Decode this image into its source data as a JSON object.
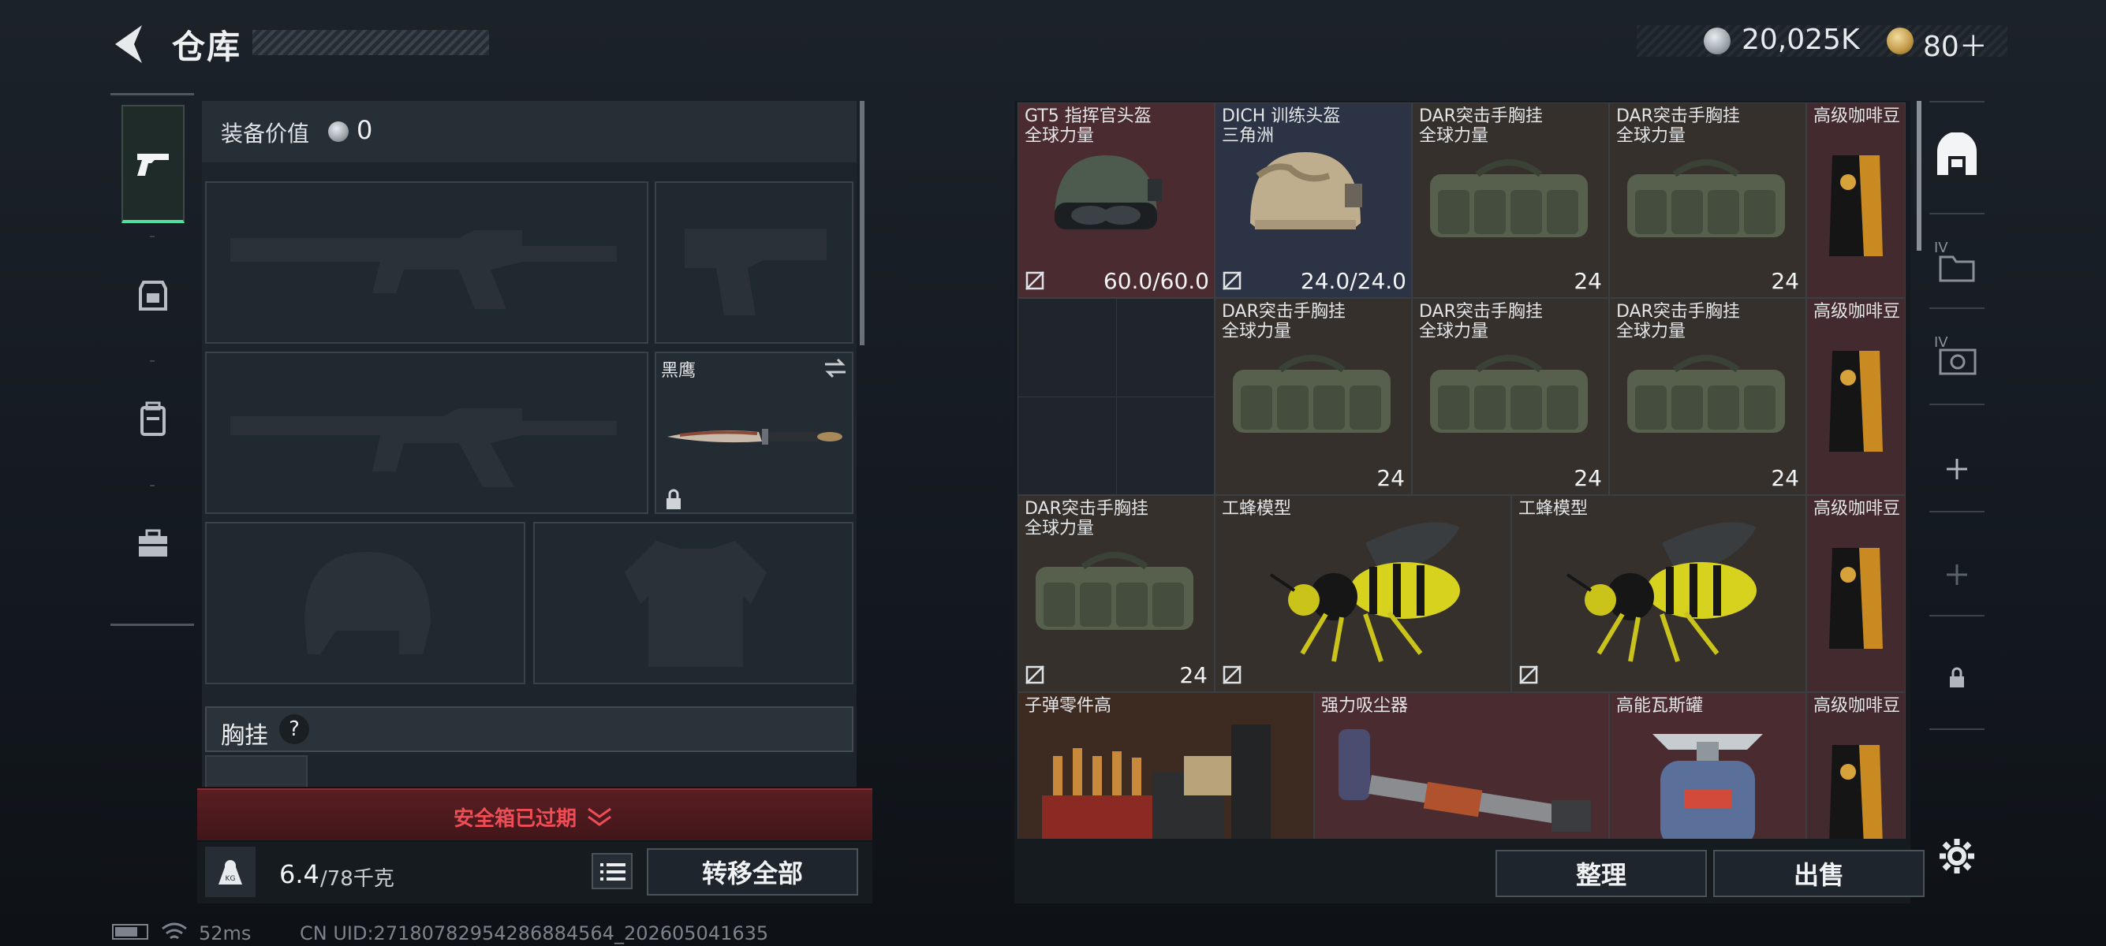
{
  "header": {
    "title": "仓库"
  },
  "currency": {
    "silver": "20,025K",
    "gold": "80＋"
  },
  "left_tabs": [
    {
      "name": "pistol-icon",
      "active": true
    },
    {
      "name": "armor-icon",
      "active": false
    },
    {
      "name": "backpack-icon",
      "active": false
    },
    {
      "name": "toolbox-icon",
      "active": false
    }
  ],
  "equipment": {
    "value_label": "装备价值",
    "value": "0",
    "melee_name": "黑鹰",
    "rig_label": "胸挂",
    "rig_help": "?"
  },
  "safe_box": {
    "label": "安全箱已过期"
  },
  "weight": {
    "current": "6.4",
    "max": "/78千克",
    "transfer_button": "转移全部"
  },
  "status": {
    "ping": "52ms",
    "uid": "CN UID:2718078295428688­4564_202605041635"
  },
  "storage": {
    "items": [
      {
        "key": "gt5",
        "line1": "GT5 指挥官头盔",
        "line2": "全球力量",
        "value": "60.0/60.0"
      },
      {
        "key": "dich",
        "line1": "DICH 训练头盔",
        "line2": "三角洲",
        "value": "24.0/24.0"
      },
      {
        "key": "dar1",
        "line1": "DAR突击手胸挂",
        "line2": "全球力量",
        "value": "24"
      },
      {
        "key": "dar2",
        "line1": "DAR突击手胸挂",
        "line2": "全球力量",
        "value": "24"
      },
      {
        "key": "coffee1",
        "line1": "高级咖啡豆",
        "line2": "",
        "value": ""
      },
      {
        "key": "dar3",
        "line1": "DAR突击手胸挂",
        "line2": "全球力量",
        "value": "24"
      },
      {
        "key": "dar4",
        "line1": "DAR突击手胸挂",
        "line2": "全球力量",
        "value": "24"
      },
      {
        "key": "dar5",
        "line1": "DAR突击手胸挂",
        "line2": "全球力量",
        "value": "24"
      },
      {
        "key": "coffee2",
        "line1": "高级咖啡豆",
        "line2": "",
        "value": ""
      },
      {
        "key": "dar6",
        "line1": "DAR突击手胸挂",
        "line2": "全球力量",
        "value": "24"
      },
      {
        "key": "bee1",
        "line1": "工蜂模型",
        "line2": "",
        "value": ""
      },
      {
        "key": "bee2",
        "line1": "工蜂模型",
        "line2": "",
        "value": ""
      },
      {
        "key": "coffee3",
        "line1": "高级咖啡豆",
        "line2": "",
        "value": ""
      },
      {
        "key": "bullet",
        "line1": "子弹零件高",
        "line2": "",
        "value": ""
      },
      {
        "key": "vacuum",
        "line1": "强力吸尘器",
        "line2": "",
        "value": ""
      },
      {
        "key": "gas",
        "line1": "高能瓦斯罐",
        "line2": "",
        "value": ""
      },
      {
        "key": "coffee4",
        "line1": "高级咖啡豆",
        "line2": "",
        "value": ""
      }
    ],
    "sort_button": "整理",
    "sell_button": "出售"
  },
  "right_tabs": {
    "tab2_tag": "IV",
    "tab3_tag": "IV"
  },
  "colors": {
    "accent_green": "#4fe0a0",
    "alert_red": "#e0454d",
    "rare_red": "#4a2b30",
    "rare_blue": "#2b3344"
  }
}
